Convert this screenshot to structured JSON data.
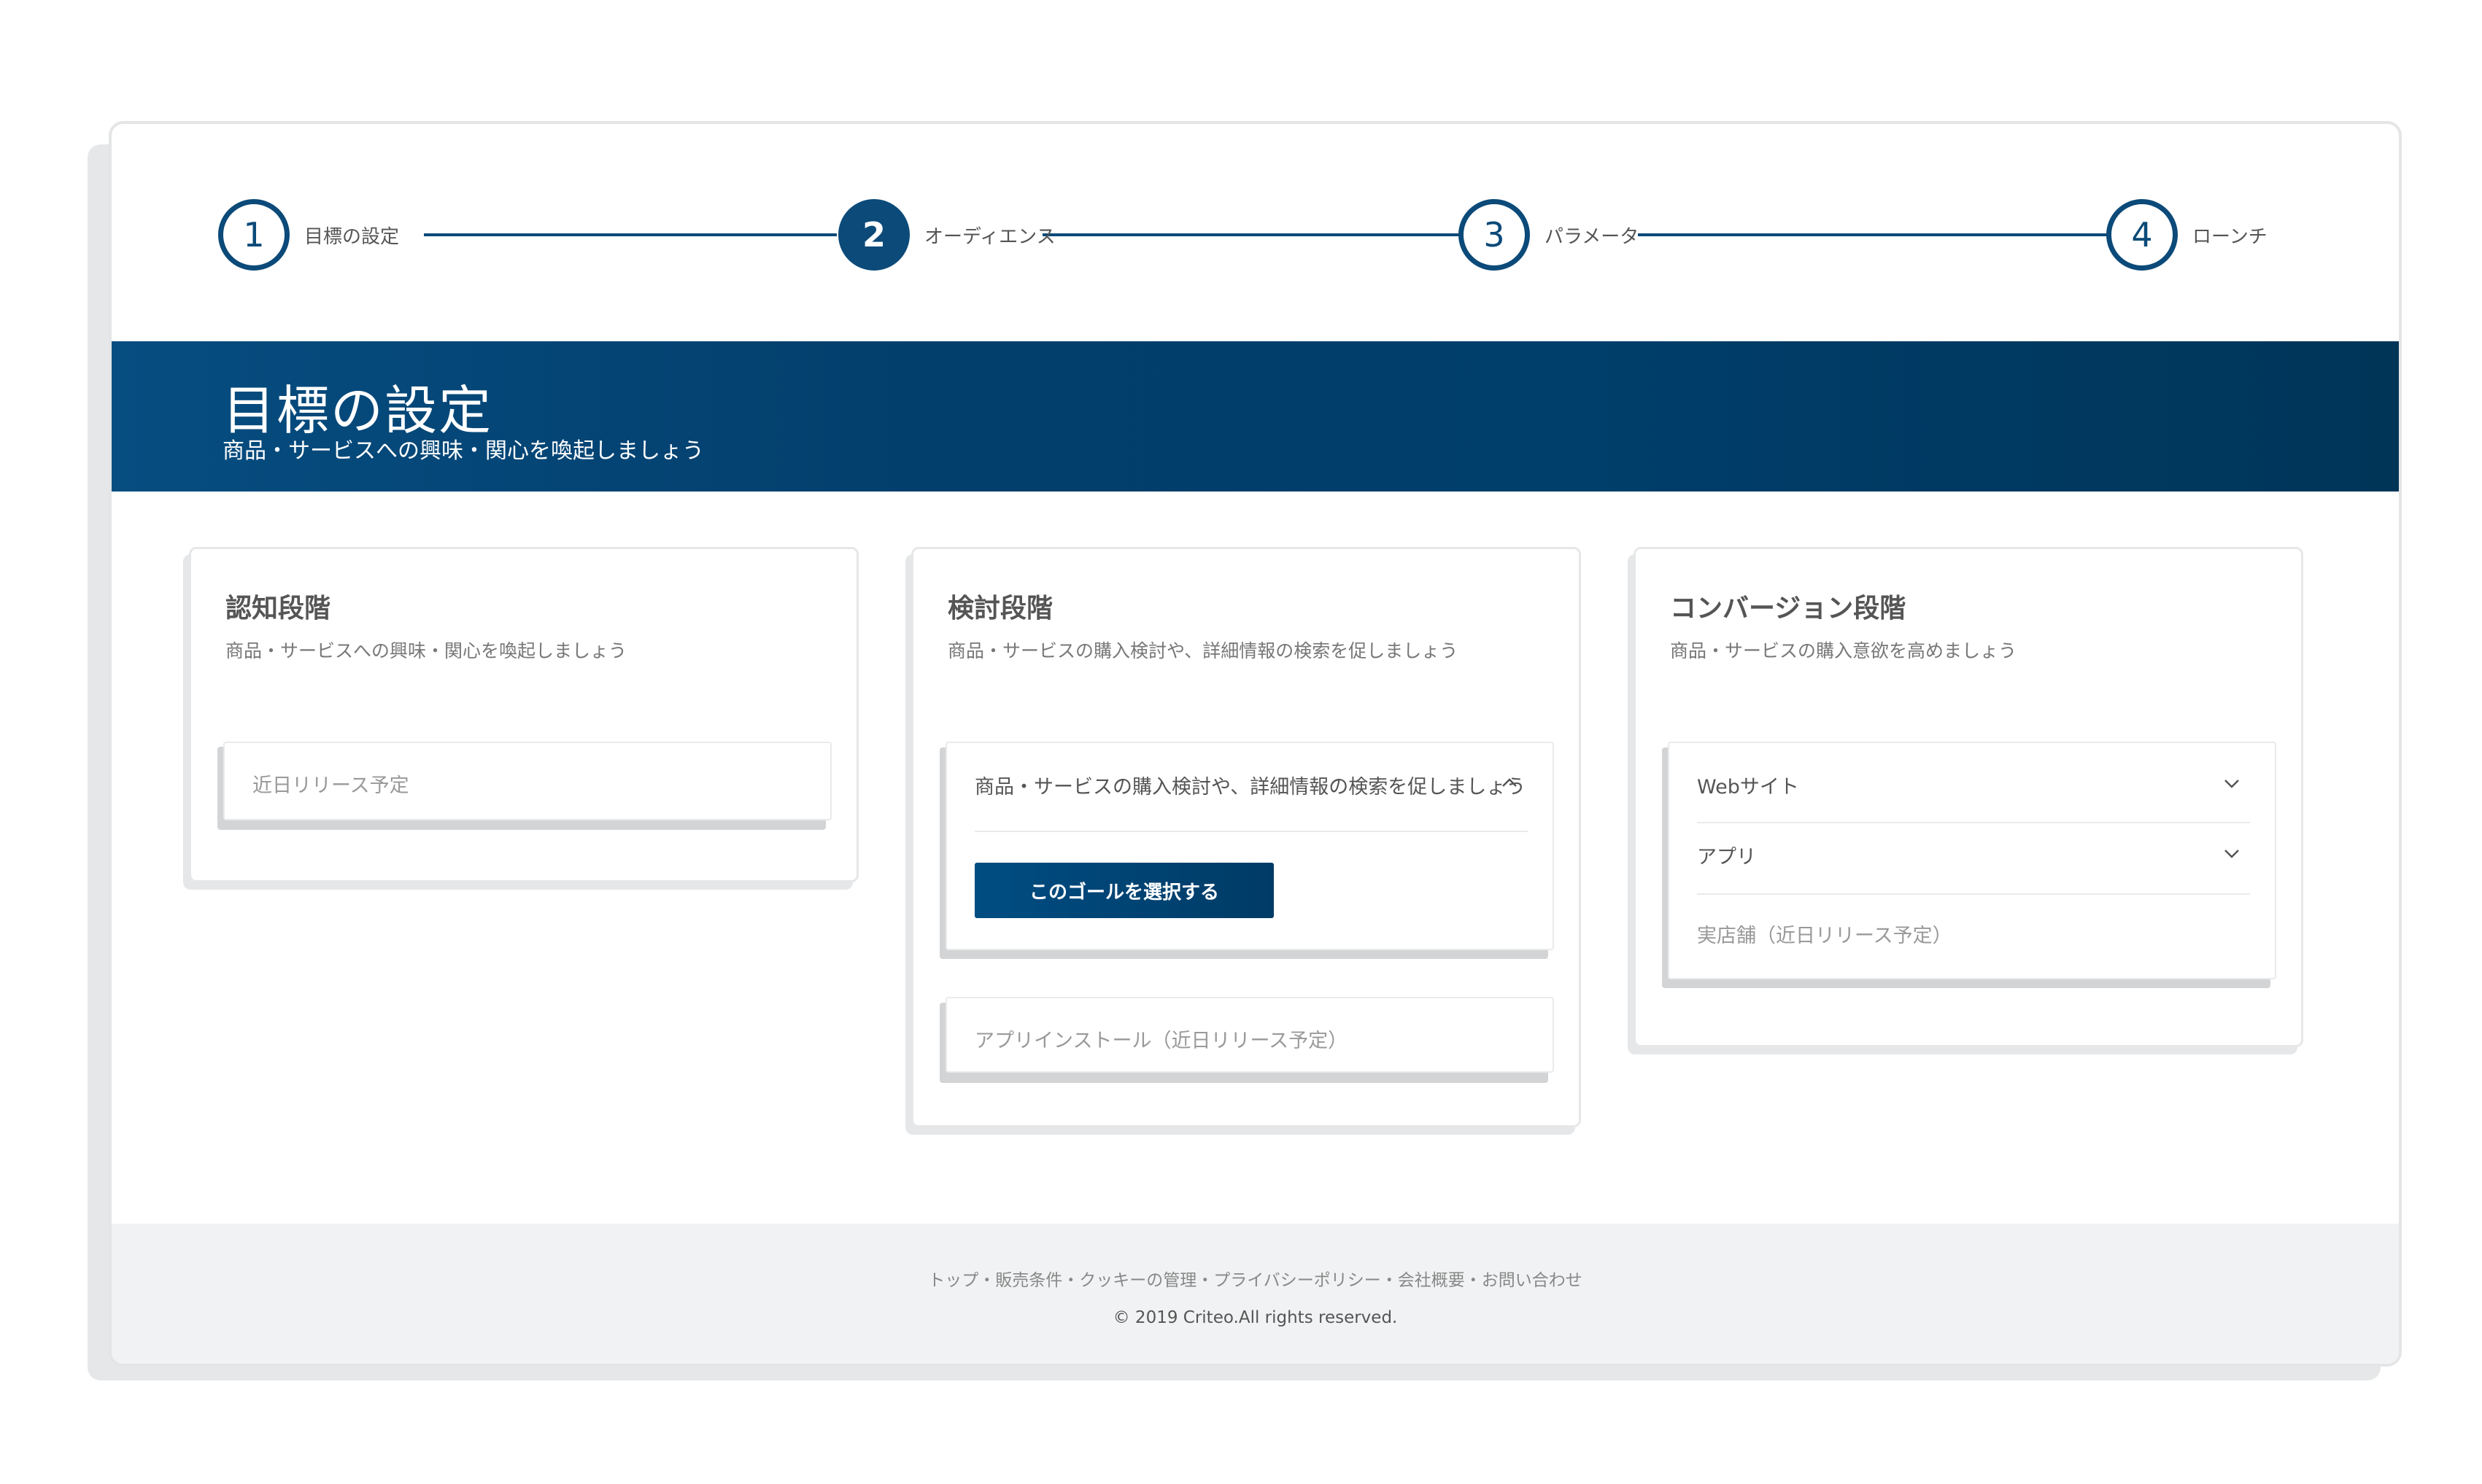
{
  "steps": [
    {
      "number": "1",
      "label": "目標の設定"
    },
    {
      "number": "2",
      "label": "オーディエンス"
    },
    {
      "number": "3",
      "label": "パラメータ"
    },
    {
      "number": "4",
      "label": "ローンチ"
    }
  ],
  "banner": {
    "title": "目標の設定",
    "subtitle": "商品・サービスへの興味・関心を喚起しましょう"
  },
  "cards": [
    {
      "title": "認知段階",
      "description": "商品・サービスへの興味・関心を喚起しましょう",
      "options": [
        {
          "label": "近日リリース予定"
        }
      ]
    },
    {
      "title": "検討段階",
      "description": "商品・サービスの購入検討や、詳細情報の検索を促しましょう",
      "expanded_option": {
        "label": "商品・サービスの購入検討や、詳細情報の検索を促しましょう",
        "button": "このゴールを選択する"
      },
      "options": [
        {
          "label": "アプリインストール（近日リリース予定）"
        }
      ]
    },
    {
      "title": "コンバージョン段階",
      "description": "商品・サービスの購入意欲を高めましょう",
      "options": [
        {
          "label": "Webサイト"
        },
        {
          "label": "アプリ"
        },
        {
          "label": "実店舗（近日リリース予定）"
        }
      ]
    }
  ],
  "footer": {
    "links": [
      "トップ",
      "販売条件",
      "クッキーの管理",
      "プライバシーポリシー",
      "会社概要",
      "お問い合わせ"
    ],
    "separator": "・",
    "copyright": "© 2019 Criteo.All rights reserved."
  },
  "colors": {
    "brand": "#0b4a79",
    "banner": "#003e6b"
  },
  "icons": {
    "chevron_down": "chevron-down-icon",
    "chevron_up": "chevron-up-icon"
  }
}
